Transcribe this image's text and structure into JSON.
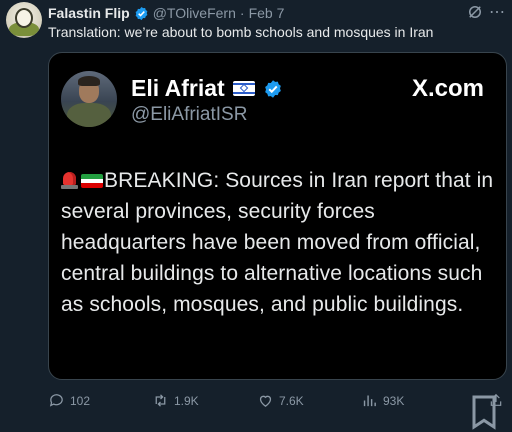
{
  "post": {
    "author_name": "Falastin Flip",
    "author_handle": "@TOliveFern",
    "separator": "·",
    "date": "Feb 7",
    "caption": "Translation: we’re about to bomb schools and mosques in Iran"
  },
  "embed": {
    "name": "Eli Afriat",
    "handle": "@EliAfriatISR",
    "brand": "X.com",
    "text": "BREAKING: Sources in Iran report that in several provinces, security forces headquarters have been moved from official, central buildings to alternative locations such as schools, mosques, and public buildings."
  },
  "actions": {
    "replies": "102",
    "reposts": "1.9K",
    "likes": "7.6K",
    "views": "93K"
  },
  "colors": {
    "background": "#15202b",
    "verified": "#1d9bf0",
    "muted": "#8b98a5"
  },
  "icons": [
    "grok-icon",
    "more-icon",
    "verified-badge-icon",
    "israel-flag-icon",
    "siren-icon",
    "iran-flag-icon",
    "reply-icon",
    "repost-icon",
    "like-icon",
    "views-icon",
    "bookmark-icon",
    "share-icon"
  ]
}
